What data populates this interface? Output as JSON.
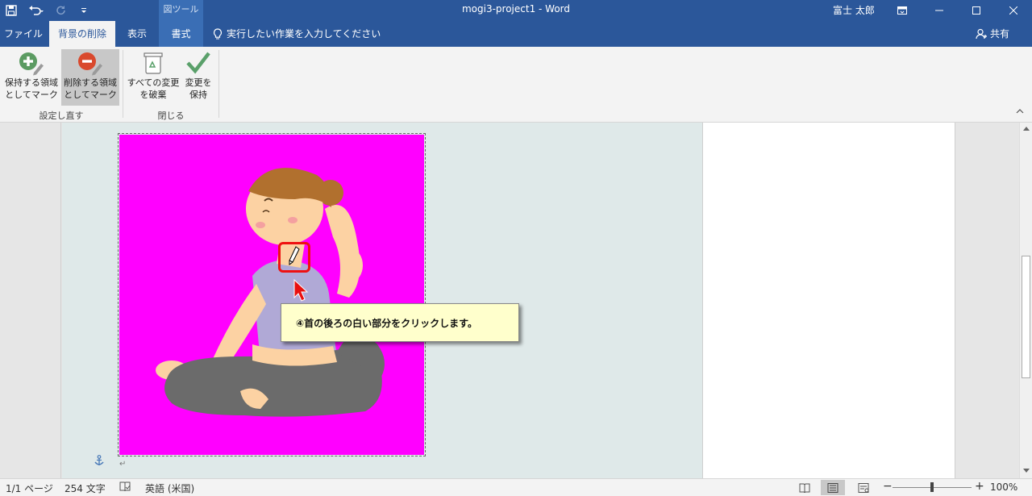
{
  "window": {
    "title": "mogi3-project1  -  Word",
    "user": "富士 太郎",
    "tool_context": "図ツール",
    "minimize_icon": "minimize-icon",
    "maximize_icon": "maximize-icon",
    "close_icon": "close-icon"
  },
  "tabs": [
    {
      "label": "ファイル"
    },
    {
      "label": "背景の削除",
      "active": true
    },
    {
      "label": "表示"
    },
    {
      "label": "書式"
    }
  ],
  "tellme": {
    "text": "実行したい作業を入力してください"
  },
  "share": {
    "label": "共有"
  },
  "ribbon": {
    "buttons": [
      {
        "line1": "保持する領域",
        "line2": "としてマーク"
      },
      {
        "line1": "削除する領域",
        "line2": "としてマーク"
      },
      {
        "line1": "すべての変更",
        "line2": "を破棄"
      },
      {
        "line1": "変更を",
        "line2": "保持"
      }
    ],
    "groups": [
      {
        "label": "設定し直す"
      },
      {
        "label": "閉じる"
      }
    ],
    "colors": {
      "keep_green": "#5b9b62",
      "remove_red": "#d9492d",
      "check_green": "#5aa06a"
    }
  },
  "document": {
    "image_bg_color": "#ff00ff",
    "callout_text": "④首の後ろの白い部分をクリックします。",
    "highlight_color": "#ee1111",
    "paragraph_mark": "↵"
  },
  "status": {
    "page": "1/1 ページ",
    "words": "254 文字",
    "language": "英語 (米国)",
    "zoom": "100%",
    "zoom_minus": "−",
    "zoom_plus": "+"
  }
}
